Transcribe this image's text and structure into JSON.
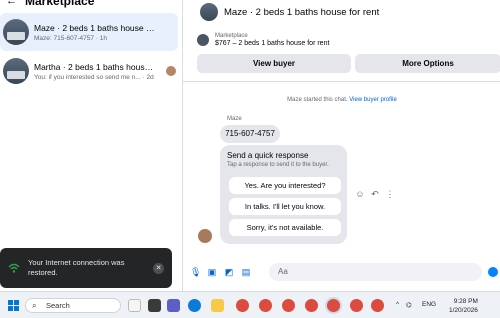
{
  "left": {
    "title": "Marketplace",
    "conversations": [
      {
        "name": "Maze · 2 beds 1 baths house for rent",
        "sub": "Maze: 715-607-4757 · 1h"
      },
      {
        "name": "Martha · 2 beds 1 baths house f...",
        "sub": "You: if you interested so send me n... · 2d"
      }
    ]
  },
  "toast": {
    "message": "Your Internet connection was restored."
  },
  "chat": {
    "title": "Maze · 2 beds 1 baths house for rent",
    "marketplace_label": "Marketplace",
    "listing": "$767 – 2 beds 1 baths house for rent",
    "view_buyer": "View buyer",
    "more_options": "More Options",
    "started_text": "Maze started this chat.",
    "view_profile": "View buyer profile",
    "sender": "Maze",
    "phone": "715-607-4757",
    "quick_title": "Send a quick response",
    "quick_sub": "Tap a response to send it to the buyer.",
    "responses": [
      "Yes. Are you interested?",
      "In talks. I'll let you know.",
      "Sorry, it's not available."
    ],
    "compose_placeholder": "Aa"
  },
  "taskbar": {
    "search": "Search",
    "lang": "ENG",
    "time": "9:28 PM",
    "date": "1/20/2026"
  }
}
